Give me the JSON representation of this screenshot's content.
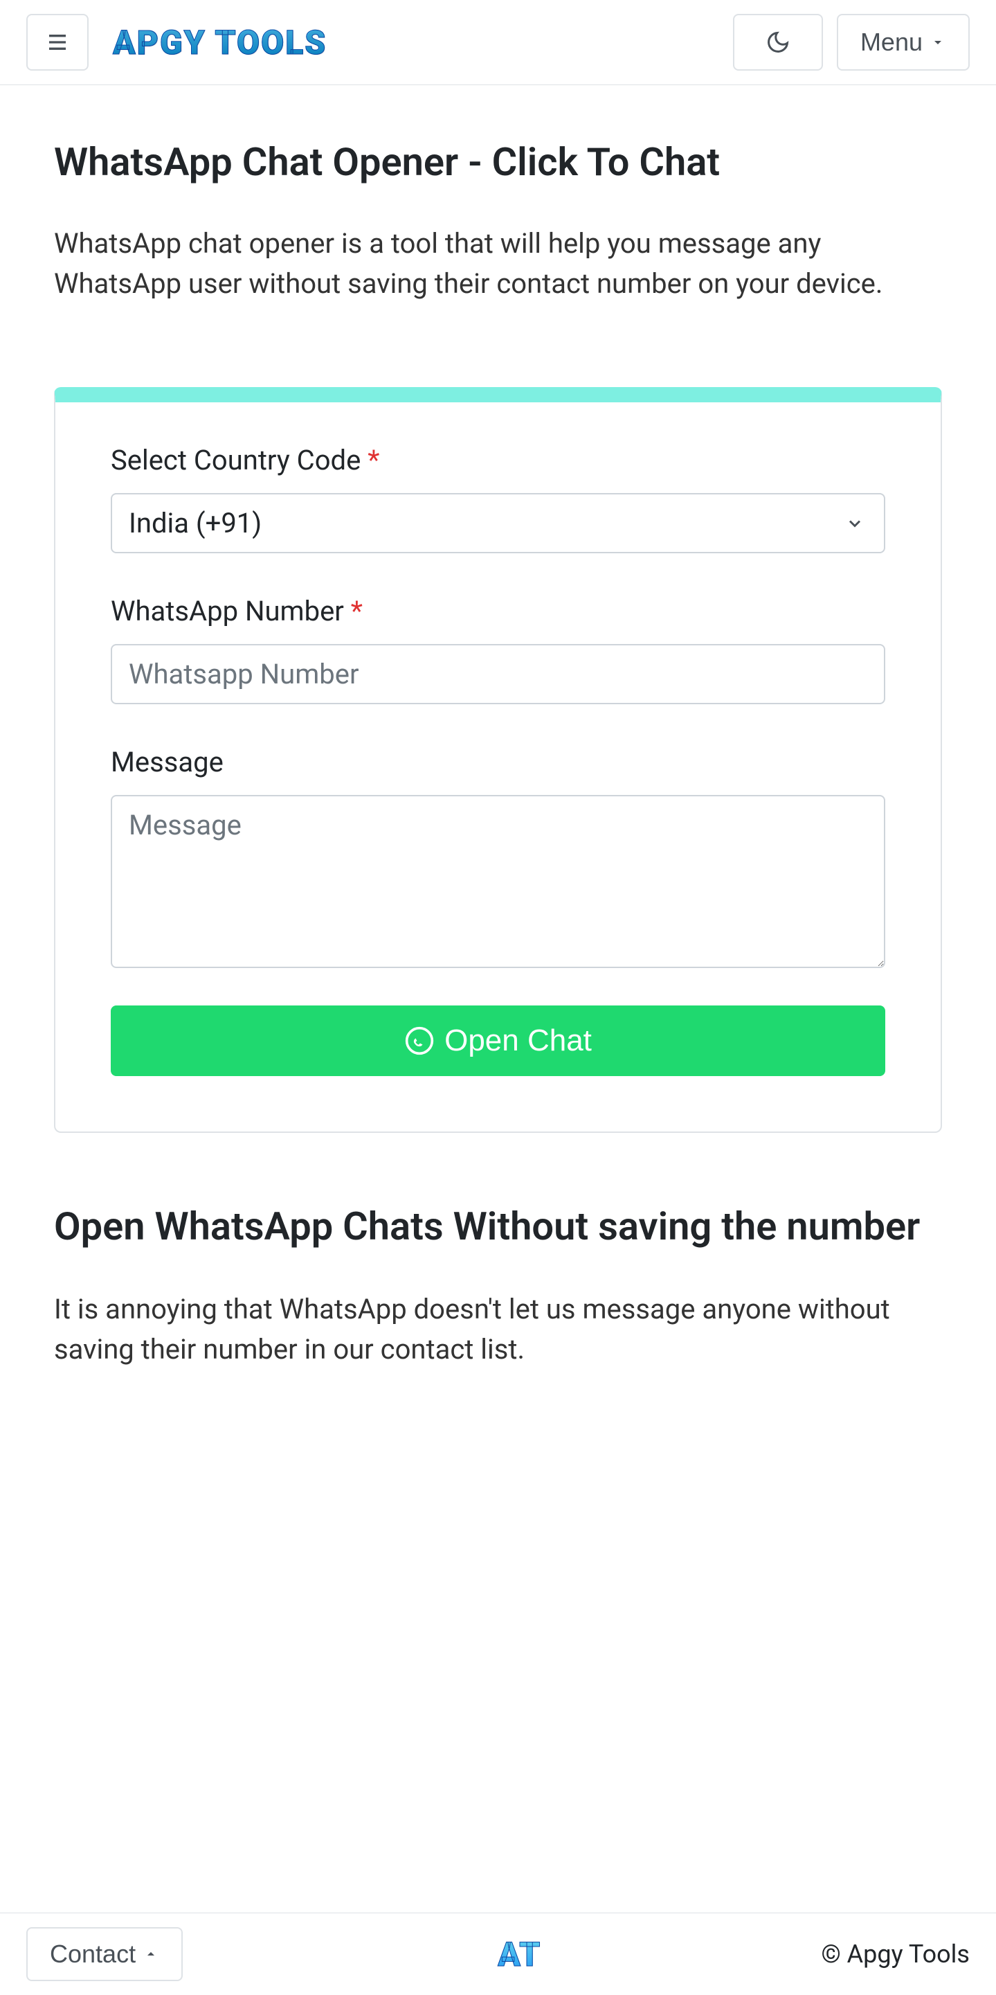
{
  "header": {
    "logo_text": "APGY TOOLS",
    "menu_label": "Menu"
  },
  "page": {
    "title": "WhatsApp Chat Opener - Click To Chat",
    "intro": "WhatsApp chat opener is a tool that will help you message any WhatsApp user without saving their contact number on your device."
  },
  "form": {
    "country_label": "Select Country Code ",
    "country_selected": "India (+91)",
    "number_label": "WhatsApp Number ",
    "number_placeholder": "Whatsapp Number",
    "message_label": "Message",
    "message_placeholder": "Message",
    "submit_label": " Open Chat",
    "required_mark": "*"
  },
  "section": {
    "heading": "Open WhatsApp Chats Without saving the number",
    "body": "It is annoying that WhatsApp doesn't let us message anyone without saving their number in our contact list."
  },
  "footer": {
    "contact_label": "Contact",
    "logo_text": "AT",
    "copyright": "© Apgy Tools"
  }
}
